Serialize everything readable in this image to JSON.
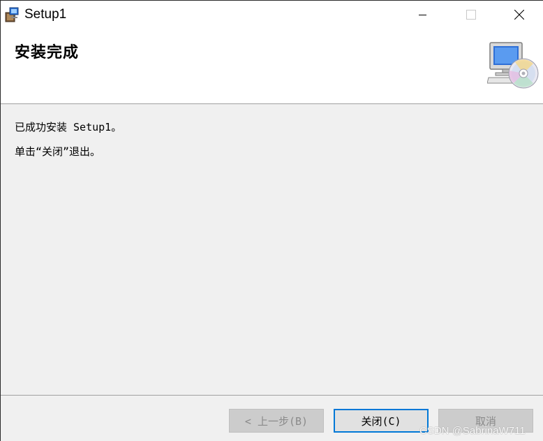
{
  "window": {
    "title": "Setup1",
    "app_icon": "installer-icon",
    "controls": {
      "minimize_icon": "minimize-icon",
      "maximize_icon": "maximize-icon",
      "close_icon": "close-icon"
    }
  },
  "header": {
    "title": "安装完成",
    "graphic_icon": "computer-cd-icon"
  },
  "content": {
    "line1": "已成功安装 Setup1。",
    "line2": "单击“关闭”退出。"
  },
  "footer": {
    "back_label": "< 上一步(B)",
    "close_label": "关闭(C)",
    "cancel_label": "取消",
    "back_enabled": false,
    "close_enabled": true,
    "cancel_enabled": false
  },
  "watermark": {
    "text": "CSDN @SabrinaW711"
  },
  "colors": {
    "accent": "#0078d7",
    "panel_bg": "#f0f0f0",
    "disabled_button_bg": "#cccccc"
  }
}
